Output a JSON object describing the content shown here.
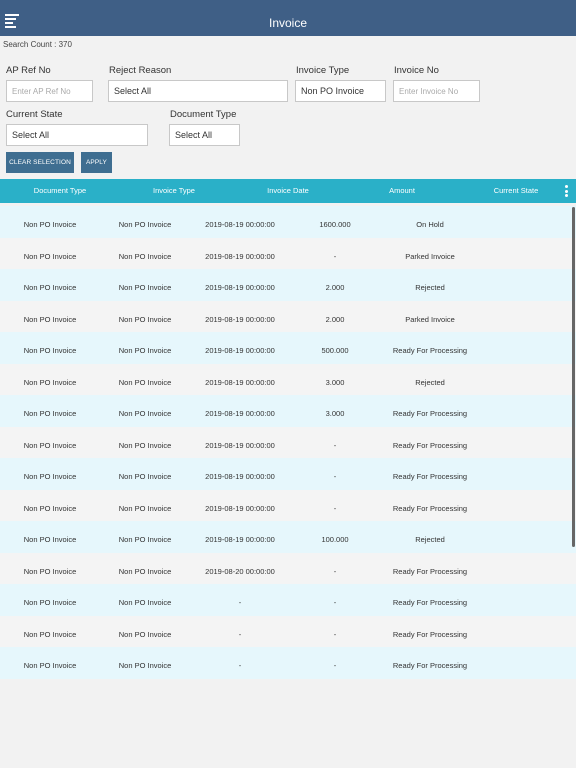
{
  "header": {
    "title": "Invoice",
    "menu_icon": "hamburger-menu-icon"
  },
  "search": {
    "count": "Search Count : 370"
  },
  "filters": {
    "ap_ref": {
      "label": "AP Ref No",
      "placeholder": "Enter AP Ref No",
      "value": ""
    },
    "reject_reason": {
      "label": "Reject Reason",
      "value": "Select All"
    },
    "invoice_type": {
      "label": "Invoice Type",
      "value": "Non PO Invoice"
    },
    "invoice_no": {
      "label": "Invoice No",
      "placeholder": "Enter Invoice No",
      "value": ""
    },
    "current_state": {
      "label": "Current State",
      "value": "Select All"
    },
    "document_type": {
      "label": "Document Type",
      "value": "Select All"
    }
  },
  "buttons": {
    "clear": "CLEAR SELECTION",
    "apply": "APPLY"
  },
  "table": {
    "headers": [
      "Document Type",
      "Invoice Type",
      "Invoice Date",
      "Amount",
      "Current State"
    ],
    "rows": [
      [
        "Non PO Invoice",
        "Non PO Invoice",
        "2019-08-19 00:00:00",
        "1600.000",
        "On Hold"
      ],
      [
        "Non PO Invoice",
        "Non PO Invoice",
        "2019-08-19 00:00:00",
        "-",
        "Parked Invoice"
      ],
      [
        "Non PO Invoice",
        "Non PO Invoice",
        "2019-08-19 00:00:00",
        "2.000",
        "Rejected"
      ],
      [
        "Non PO Invoice",
        "Non PO Invoice",
        "2019-08-19 00:00:00",
        "2.000",
        "Parked Invoice"
      ],
      [
        "Non PO Invoice",
        "Non PO Invoice",
        "2019-08-19 00:00:00",
        "500.000",
        "Ready For Processing"
      ],
      [
        "Non PO Invoice",
        "Non PO Invoice",
        "2019-08-19 00:00:00",
        "3.000",
        "Rejected"
      ],
      [
        "Non PO Invoice",
        "Non PO Invoice",
        "2019-08-19 00:00:00",
        "3.000",
        "Ready For Processing"
      ],
      [
        "Non PO Invoice",
        "Non PO Invoice",
        "2019-08-19 00:00:00",
        "-",
        "Ready For Processing"
      ],
      [
        "Non PO Invoice",
        "Non PO Invoice",
        "2019-08-19 00:00:00",
        "-",
        "Ready For Processing"
      ],
      [
        "Non PO Invoice",
        "Non PO Invoice",
        "2019-08-19 00:00:00",
        "-",
        "Ready For Processing"
      ],
      [
        "Non PO Invoice",
        "Non PO Invoice",
        "2019-08-19 00:00:00",
        "100.000",
        "Rejected"
      ],
      [
        "Non PO Invoice",
        "Non PO Invoice",
        "2019-08-20 00:00:00",
        "-",
        "Ready For Processing"
      ],
      [
        "Non PO Invoice",
        "Non PO Invoice",
        "-",
        "-",
        "Ready For Processing"
      ],
      [
        "Non PO Invoice",
        "Non PO Invoice",
        "-",
        "-",
        "Ready For Processing"
      ],
      [
        "Non PO Invoice",
        "Non PO Invoice",
        "-",
        "-",
        "Ready For Processing"
      ]
    ]
  },
  "colors": {
    "header_bg": "#3f5f86",
    "table_header_bg": "#2ab0c8",
    "button_bg": "#3f6e91",
    "row_alt_bg": "#e6f7fc"
  }
}
